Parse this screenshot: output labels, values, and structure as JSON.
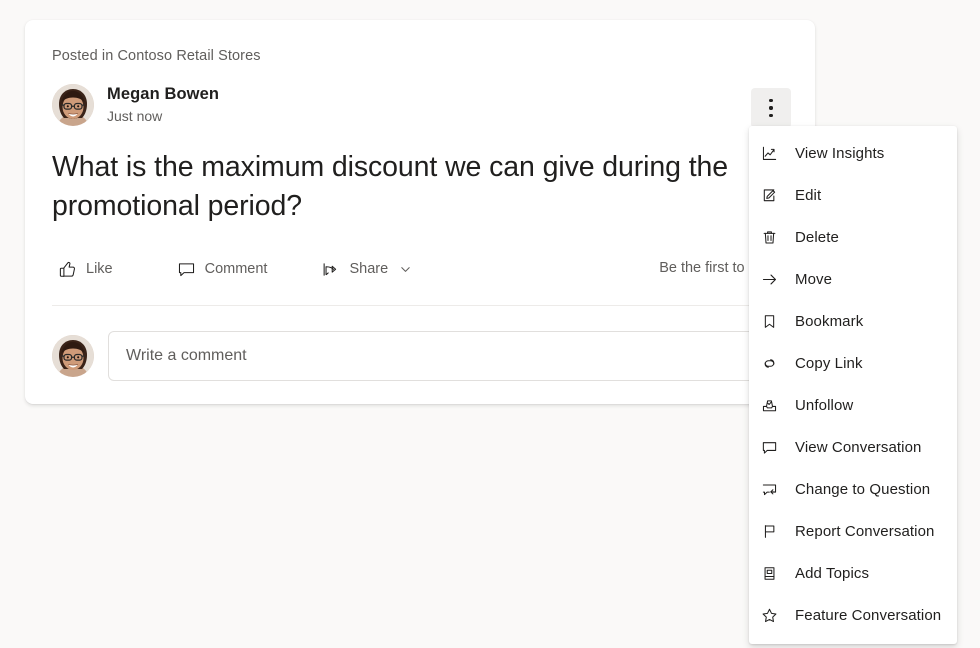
{
  "post": {
    "posted_in": "Posted in Contoso Retail Stores",
    "author_name": "Megan Bowen",
    "timestamp": "Just now",
    "body": "What is the maximum discount we can give during the promotional period?",
    "first_like_text": "Be the first to like this",
    "more_button_label": "More options",
    "avatar_alt": "Megan Bowen avatar"
  },
  "actions": [
    {
      "label": "Like",
      "icon": "thumbs-up-icon"
    },
    {
      "label": "Comment",
      "icon": "comment-icon"
    },
    {
      "label": "Share",
      "icon": "share-icon"
    }
  ],
  "comment": {
    "placeholder": "Write a comment",
    "avatar_alt": "Your avatar"
  },
  "menu": {
    "items": [
      {
        "label": "View Insights",
        "icon": "insights-chart-icon"
      },
      {
        "label": "Edit",
        "icon": "edit-pencil-icon"
      },
      {
        "label": "Delete",
        "icon": "trash-icon"
      },
      {
        "label": "Move",
        "icon": "arrow-right-icon"
      },
      {
        "label": "Bookmark",
        "icon": "bookmark-icon"
      },
      {
        "label": "Copy Link",
        "icon": "link-icon"
      },
      {
        "label": "Unfollow",
        "icon": "unfollow-inbox-icon"
      },
      {
        "label": "View Conversation",
        "icon": "conversation-icon"
      },
      {
        "label": "Change to Question",
        "icon": "change-to-question-icon"
      },
      {
        "label": "Report Conversation",
        "icon": "flag-icon"
      },
      {
        "label": "Add Topics",
        "icon": "topics-book-icon"
      },
      {
        "label": "Feature Conversation",
        "icon": "star-icon"
      }
    ]
  },
  "colors": {
    "page_background": "#faf9f8",
    "card_background": "#ffffff",
    "primary_text": "#201f1e",
    "secondary_text": "#605e5c",
    "divider": "#edebe9",
    "more_button_background": "#f0efee"
  }
}
